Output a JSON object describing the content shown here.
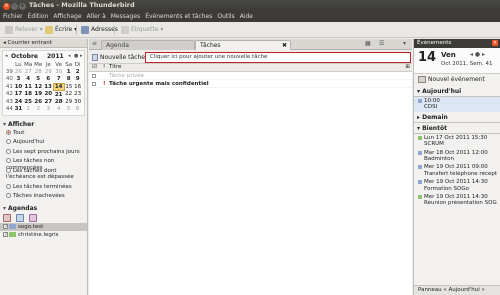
{
  "window": {
    "title": "Tâches - Mozilla Thunderbird"
  },
  "menu": [
    "Fichier",
    "Édition",
    "Affichage",
    "Aller à",
    "Messages",
    "Événements et tâches",
    "Outils",
    "Aide"
  ],
  "toolbar": {
    "receive": "Relever",
    "write": "Écrire",
    "address": "Adresses",
    "tag": "Étiquette"
  },
  "left": {
    "mail_header": "Courrier entrant",
    "calendar": {
      "month": "Octobre",
      "year": "2011",
      "day_names": [
        "Lu",
        "Ma",
        "Me",
        "Je",
        "Ve",
        "Sa",
        "Di"
      ],
      "weeks": [
        {
          "w": "39",
          "d": [
            "26",
            "27",
            "28",
            "29",
            "30",
            "1",
            "2"
          ]
        },
        {
          "w": "40",
          "d": [
            "3",
            "4",
            "5",
            "6",
            "7",
            "8",
            "9"
          ]
        },
        {
          "w": "41",
          "d": [
            "10",
            "11",
            "12",
            "13",
            "14",
            "15",
            "16"
          ]
        },
        {
          "w": "42",
          "d": [
            "17",
            "18",
            "19",
            "20",
            "21",
            "22",
            "23"
          ]
        },
        {
          "w": "43",
          "d": [
            "24",
            "25",
            "26",
            "27",
            "28",
            "29",
            "30"
          ]
        },
        {
          "w": "44",
          "d": [
            "31",
            "1",
            "2",
            "3",
            "4",
            "5",
            "6"
          ]
        }
      ],
      "selected_day": "14"
    },
    "filter_title": "Afficher",
    "filters": [
      "Tout",
      "Aujourd'hui",
      "Les sept prochains jours",
      "Les tâches non commencées",
      "Les tâches dont l'échéance est dépassée",
      "Les tâches terminées",
      "Tâches inachevées"
    ],
    "agendas_title": "Agendas",
    "agendas": [
      {
        "name": "sogo.test",
        "color": "#8fa8d0"
      },
      {
        "name": "christine.legris",
        "color": "#8ec46a"
      }
    ]
  },
  "tabs": [
    {
      "label": "Agenda"
    },
    {
      "label": "Tâches"
    }
  ],
  "tasks": {
    "new_task_button": "Nouvelle tâche",
    "quick_add_placeholder": "Cliquer ici pour ajouter une nouvelle tâche",
    "column_title": "Titre",
    "rows": [
      {
        "title": "Tâche privée",
        "priority": ""
      },
      {
        "title": "Tâche urgente mais confidentiel",
        "priority": "!"
      }
    ]
  },
  "right": {
    "header": "Événements",
    "day_number": "14",
    "day_name": "Ven",
    "date_sub": "Oct 2011, Sem. 41",
    "new_event": "Nouvel événement",
    "groups": [
      {
        "title": "Aujourd'hui",
        "events": [
          {
            "l1": "10:00",
            "l2": "CDSI",
            "color": "#8fa8d0"
          }
        ]
      },
      {
        "title": "Demain",
        "events": []
      },
      {
        "title": "Bientôt",
        "events": [
          {
            "l1": "Lun 17 Oct 2011 15:30",
            "l2": "SCRUM",
            "color": "#8ec46a"
          },
          {
            "l1": "Mar 18 Oct 2011 12:00",
            "l2": "Badminton",
            "color": "#8fa8d0"
          },
          {
            "l1": "Mer 19 Oct 2011 09:00",
            "l2": "Transfert téléphone réceptio",
            "color": "#8fa8d0"
          },
          {
            "l1": "Mer 19 Oct 2011 14:30",
            "l2": "Formation SOGo",
            "color": "#8fa8d0"
          },
          {
            "l1": "Mer 19 Oct 2011 14:30",
            "l2": "Réunion présentation SOGo",
            "color": "#8ec46a"
          }
        ]
      }
    ],
    "footer": "Panneau « Aujourd'hui »"
  }
}
